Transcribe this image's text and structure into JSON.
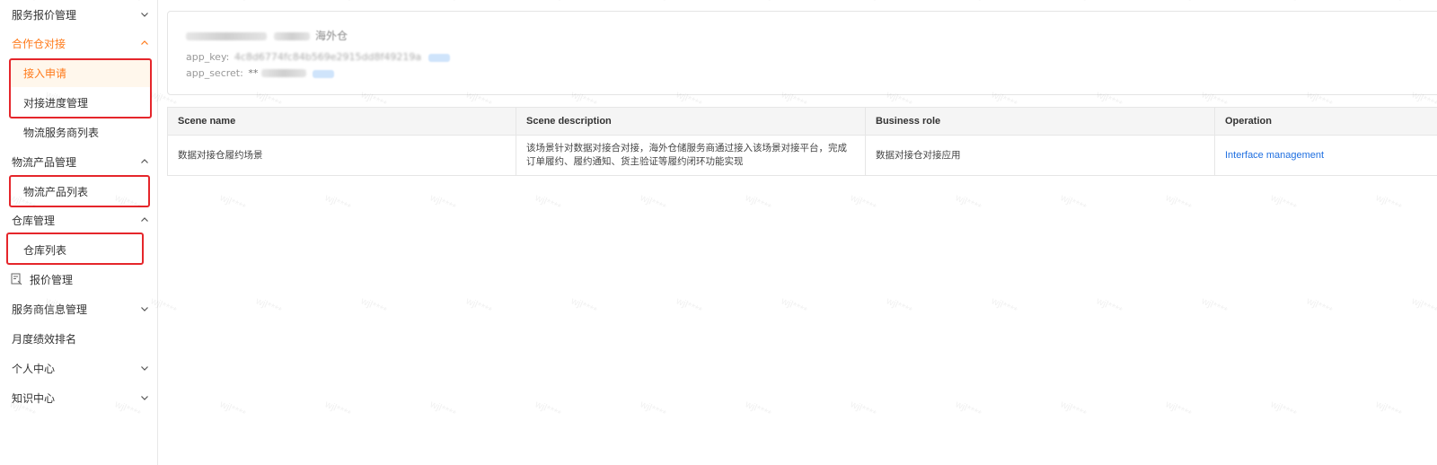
{
  "sidebar": {
    "items": [
      {
        "label": "服务报价管理",
        "type": "parent",
        "chevron": "down",
        "active": false
      },
      {
        "label": "合作仓对接",
        "type": "parent",
        "chevron": "up",
        "active": true
      },
      {
        "label": "接入申请",
        "type": "child",
        "active": true
      },
      {
        "label": "对接进度管理",
        "type": "child",
        "active": false
      },
      {
        "label": "物流服务商列表",
        "type": "child",
        "active": false
      },
      {
        "label": "物流产品管理",
        "type": "parent",
        "chevron": "up",
        "active": false
      },
      {
        "label": "物流产品列表",
        "type": "child",
        "active": false
      },
      {
        "label": "仓库管理",
        "type": "parent",
        "chevron": "up",
        "active": false
      },
      {
        "label": "仓库列表",
        "type": "child",
        "active": false
      },
      {
        "label": "报价管理",
        "type": "parent",
        "icon": "document-icon",
        "active": false
      },
      {
        "label": "服务商信息管理",
        "type": "parent",
        "chevron": "down",
        "active": false
      },
      {
        "label": "月度绩效排名",
        "type": "parent",
        "active": false
      },
      {
        "label": "个人中心",
        "type": "parent",
        "chevron": "down",
        "active": false
      },
      {
        "label": "知识中心",
        "type": "parent",
        "chevron": "down",
        "active": false
      }
    ],
    "highlight_color": "#e5262b",
    "accent_color": "#ff7a1a"
  },
  "app_info": {
    "name": "海外仓",
    "app_key_label": "app_key:",
    "app_key_value": "4c8d6774fc84b569e2915dd8f49219a",
    "app_secret_label": "app_secret:",
    "app_secret_value": "**"
  },
  "table": {
    "headers": [
      "Scene name",
      "Scene description",
      "Business role",
      "Operation"
    ],
    "rows": [
      {
        "scene_name": "数据对接仓履约场景",
        "scene_description": "该场景针对数据对接合对接，海外仓储服务商通过接入该场景对接平台，完成订单履约、履约通知、货主验证等履约闭环功能实现",
        "business_role": "数据对接仓对接应用",
        "operation": "Interface management"
      }
    ]
  },
  "watermark": "wjl****",
  "colors": {
    "link": "#1f6fe0",
    "header_bg": "#f5f5f5",
    "border": "#e6e6e6"
  }
}
